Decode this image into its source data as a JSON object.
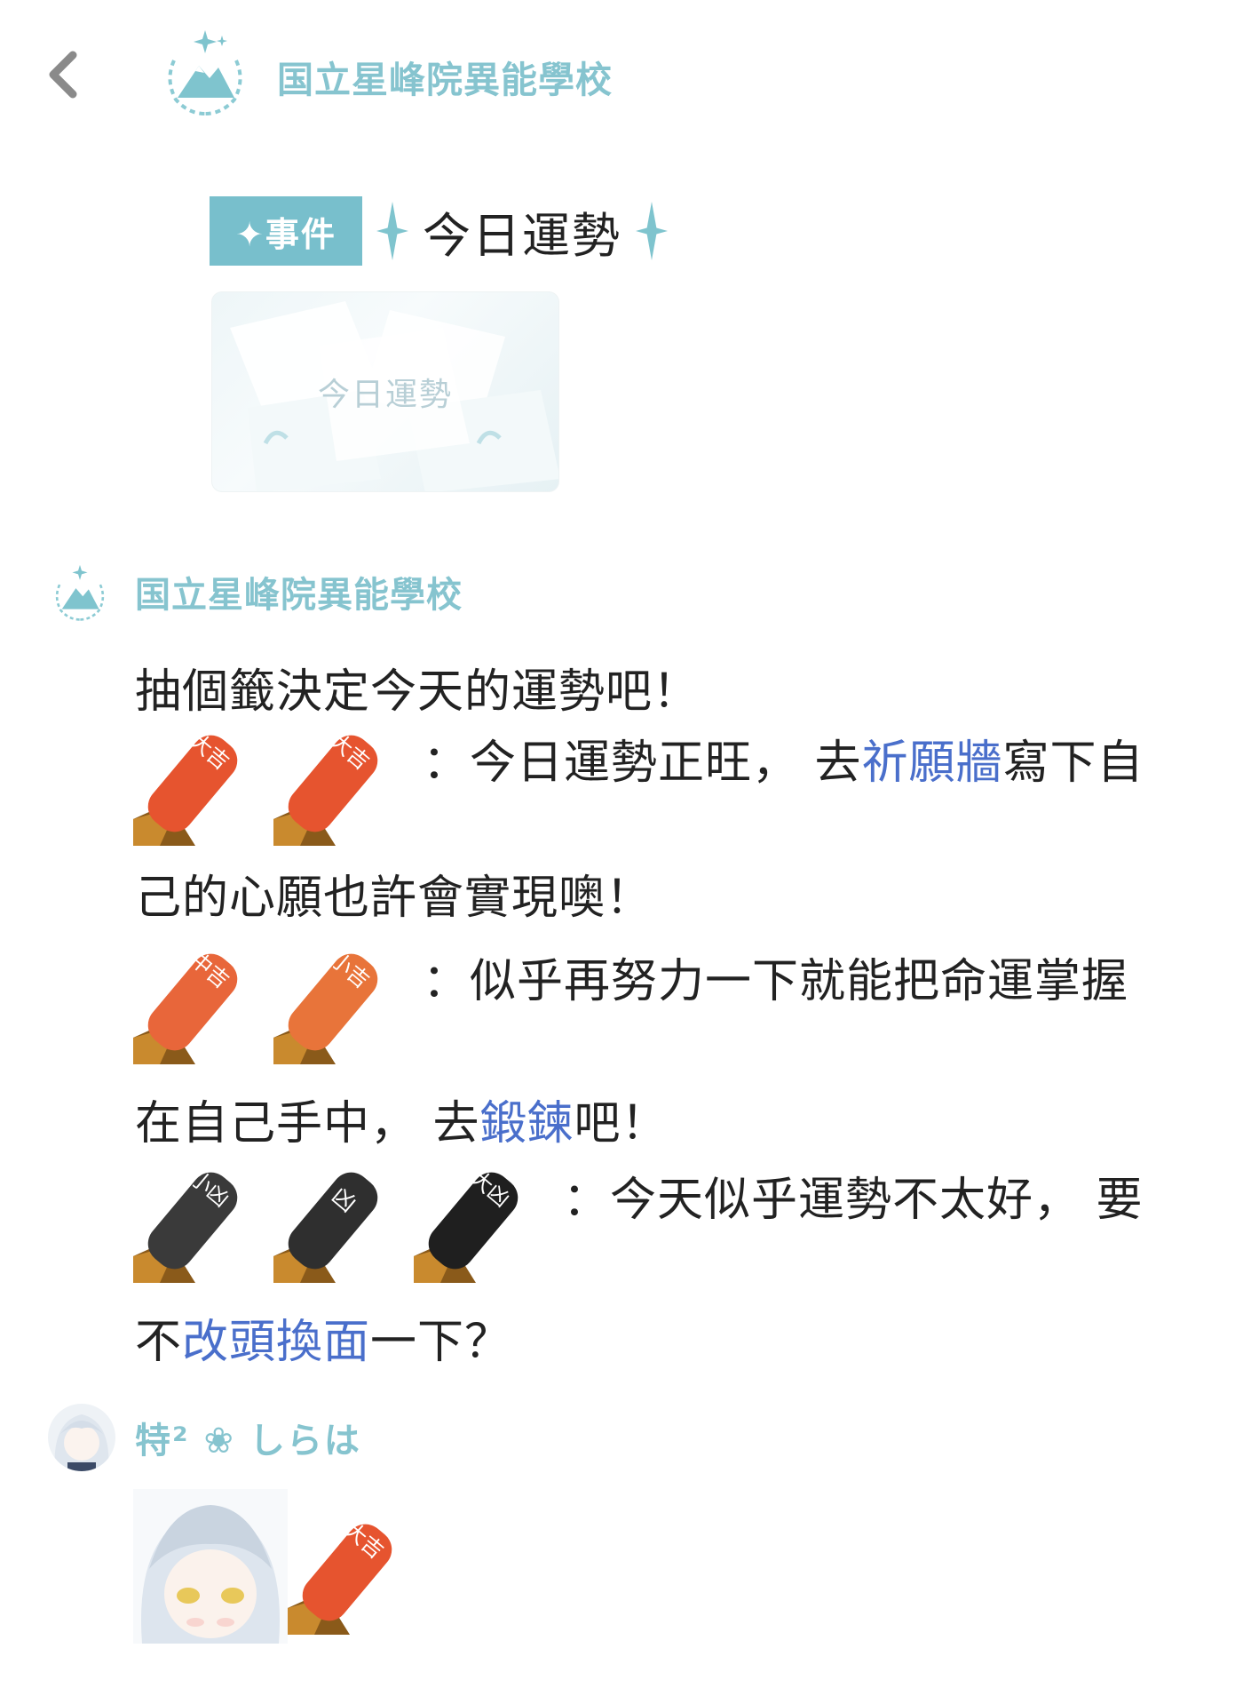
{
  "header": {
    "back_icon": "chevron-left-icon",
    "logo_icon": "mountain-laurel-logo-icon",
    "title": "国立星峰院異能學校"
  },
  "event": {
    "tag": "✦事件",
    "title": "今日運勢",
    "card_caption": "今日運勢"
  },
  "post": {
    "author": "国立星峰院異能學校",
    "line1": "抽個籤決定今天的運勢吧！",
    "line2_pre": "：今日運勢正旺， 去",
    "line2_link": "祈願牆",
    "line2_post": "寫下自",
    "line3": "己的心願也許會實現噢！",
    "line4": "：似乎再努力一下就能把命運掌握",
    "line5_pre": "在自己手中， 去",
    "line5_link": "鍛鍊",
    "line5_post": "吧！",
    "line6": "：今天似乎運勢不太好， 要",
    "line7_pre": "不",
    "line7_link": "改頭換面",
    "line7_post": "一下？",
    "sticks": {
      "daikichi": "大吉",
      "chukichi": "中吉",
      "shokichi": "小吉",
      "shokyo": "小凶",
      "kyo": "凶",
      "daikyo": "大凶"
    }
  },
  "reply": {
    "user_name": "特² ❀ しらは",
    "stick_label": "大吉"
  },
  "colors": {
    "accent_teal": "#86c4cf",
    "tag_bg": "#78bfcc",
    "link_blue": "#4a6fcb",
    "stick_red": "#e6542f",
    "stick_orange": "#e8743a",
    "stick_black": "#2f2f2f"
  }
}
